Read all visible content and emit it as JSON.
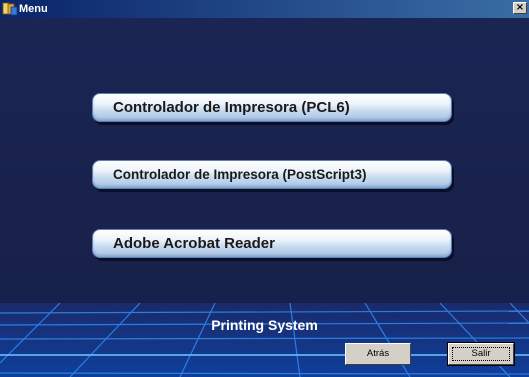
{
  "window": {
    "title": "Menu",
    "close_label": "×"
  },
  "menu": {
    "items": [
      {
        "label": "Controlador de Impresora (PCL6)"
      },
      {
        "label": "Controlador de Impresora (PostScript3)"
      },
      {
        "label": "Adobe Acrobat Reader"
      }
    ]
  },
  "footer": {
    "title": "Printing System",
    "back_label": "Atrás",
    "exit_label": "Salir"
  },
  "colors": {
    "background": "#17214a",
    "grid": "#1e6fd8",
    "button_face": "#d4d0c8"
  }
}
